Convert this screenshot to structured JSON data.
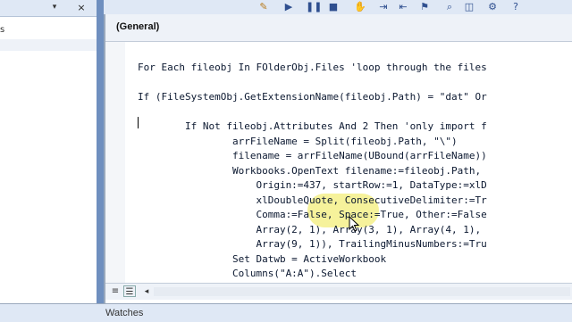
{
  "project_pane": {
    "row_label": "s",
    "dropdown_glyph": "▾",
    "close_glyph": "×"
  },
  "toolbar": {
    "icons": [
      "design-mode-icon",
      "run-icon",
      "pause-icon",
      "reset-icon",
      "hand-icon",
      "indent-icon",
      "outdent-icon",
      "toggle-bookmark-icon",
      "find-icon",
      "settings-icon"
    ]
  },
  "code_window": {
    "object_combo": "(General)",
    "lines": [
      "For Each fileobj In FOlderObj.Files 'loop through the files",
      "If (FileSystemObj.GetExtensionName(fileobj.Path) = \"dat\" Or",
      "",
      "        If Not fileobj.Attributes And 2 Then 'only import f",
      "                arrFileName = Split(fileobj.Path, \"\\\")",
      "                filename = arrFileName(UBound(arrFileName))",
      "                Workbooks.OpenText filename:=fileobj.Path,",
      "                    Origin:=437, startRow:=1, DataType:=xlD",
      "                    xlDoubleQuote, ConsecutiveDelimiter:=Tr",
      "                    Comma:=False, Space:=True, Other:=False",
      "                    Array(2, 1), Array(3, 1), Array(4, 1),",
      "                    Array(9, 1)), TrailingMinusNumbers:=Tru",
      "                Set Datwb = ActiveWorkbook",
      "                Columns(\"A:A\").Select"
    ],
    "bottom_icons": {
      "procedure_view": "≡",
      "full_module_view": "☰",
      "scroll_left": "◂"
    }
  },
  "watches": {
    "label": "Watches"
  }
}
